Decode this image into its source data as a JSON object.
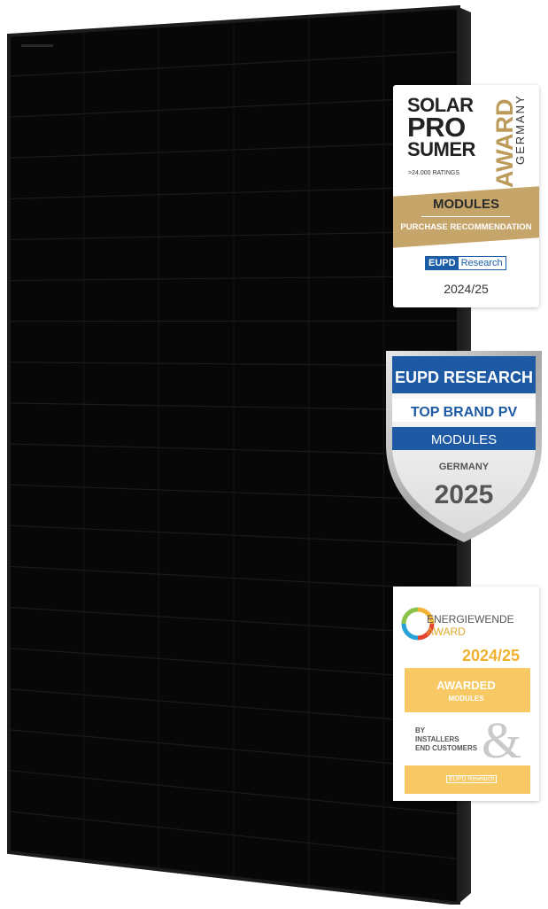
{
  "badge_solar": {
    "line1": "SOLAR",
    "line2": "PRO",
    "line3": "SUMER",
    "award": "AWARD",
    "country": "GERMANY",
    "ratings": ">24.000 RATINGS",
    "category": "MODULES",
    "subtitle": "PURCHASE RECOMMENDATION",
    "eupd_1": "EUPD",
    "eupd_2": "Research",
    "year": "2024/25"
  },
  "badge_top_brand": {
    "header": "EUPD RESEARCH",
    "title": "TOP BRAND PV",
    "category": "MODULES",
    "country": "GERMANY",
    "year": "2025"
  },
  "badge_energiewende": {
    "name_1": "ENERGIEWENDE",
    "name_2": "AWARD",
    "year": "2024/25",
    "awarded": "AWARDED",
    "category": "MODULES",
    "by_1": "BY",
    "by_2": "INSTALLERS",
    "by_3": "END CUSTOMERS",
    "ampersand": "&",
    "footer": "EUPD Research"
  },
  "colors": {
    "panel": "#0a0a0a",
    "gold": "#c6a56b",
    "eupd_blue": "#1a5ea8",
    "energiewende_yellow": "#f7c964"
  }
}
